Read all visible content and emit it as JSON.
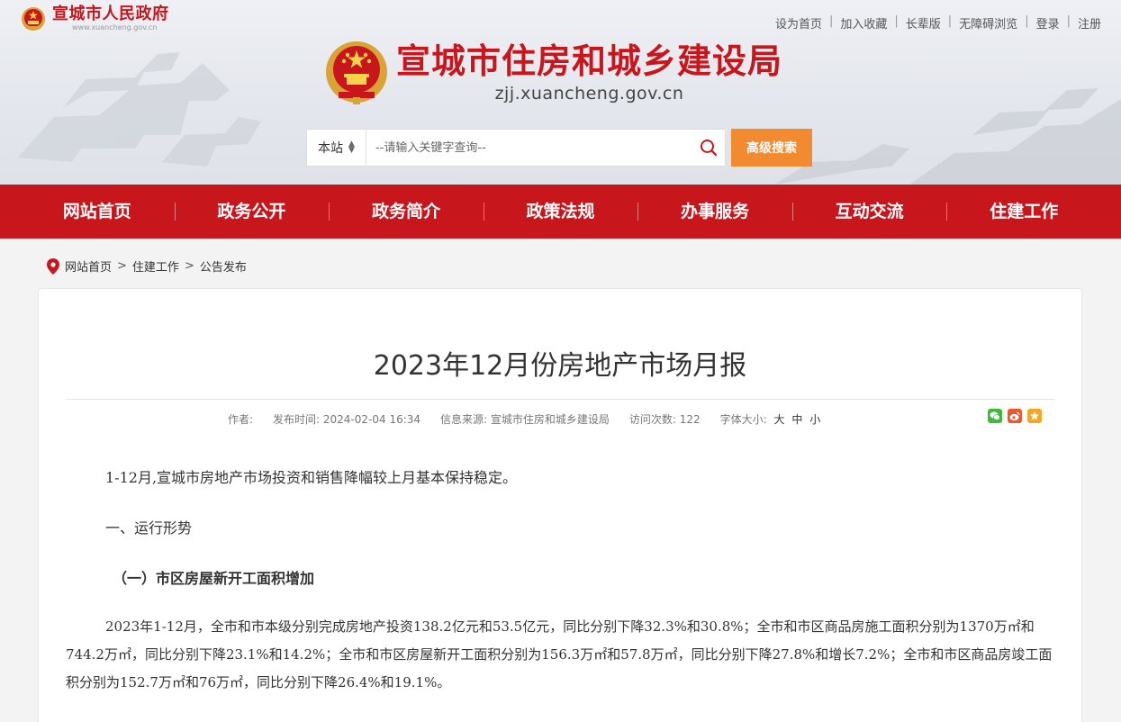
{
  "gov": {
    "name": "宣城市人民政府",
    "url": "www.xuancheng.gov.cn"
  },
  "toplinks": [
    "设为首页",
    "加入收藏",
    "长辈版",
    "无障碍浏览",
    "登录",
    "注册"
  ],
  "site": {
    "name": "宣城市住房和城乡建设局",
    "url": "zjj.xuancheng.gov.cn"
  },
  "search": {
    "scope": "本站",
    "placeholder": "--请输入关键字查询--",
    "advanced": "高级搜索"
  },
  "nav": [
    "网站首页",
    "政务公开",
    "政务简介",
    "政策法规",
    "办事服务",
    "互动交流",
    "住建工作"
  ],
  "breadcrumb": {
    "home": "网站首页",
    "level1": "住建工作",
    "level2": "公告发布",
    "sep": ">"
  },
  "article": {
    "title": "2023年12月份房地产市场月报",
    "author_label": "作者:",
    "publish": "发布时间: 2024-02-04 16:34",
    "source": "信息来源: 宣城市住房和城乡建设局",
    "visits": "访问次数: 122",
    "fontsize_label": "字体大小:",
    "size_large": "大",
    "size_medium": "中",
    "size_small": "小",
    "p1": "1-12月,宣城市房地产市场投资和销售降幅较上月基本保持稳定。",
    "h1": "一、运行形势",
    "h2": "（一）市区房屋新开工面积增加",
    "p2": "2023年1-12月，全市和市本级分别完成房地产投资138.2亿元和53.5亿元，同比分别下降32.3%和30.8%；全市和市区商品房施工面积分别为1370万㎡和744.2万㎡，同比分别下降23.1%和14.2%；全市和市区房屋新开工面积分别为156.3万㎡和57.8万㎡，同比分别下降27.8%和增长7.2%；全市和市区商品房竣工面积分别为152.7万㎡和76万㎡，同比分别下降26.4%和19.1%。"
  },
  "colors": {
    "brand_red": "#c8161d",
    "search_orange": "#f28a2f"
  }
}
